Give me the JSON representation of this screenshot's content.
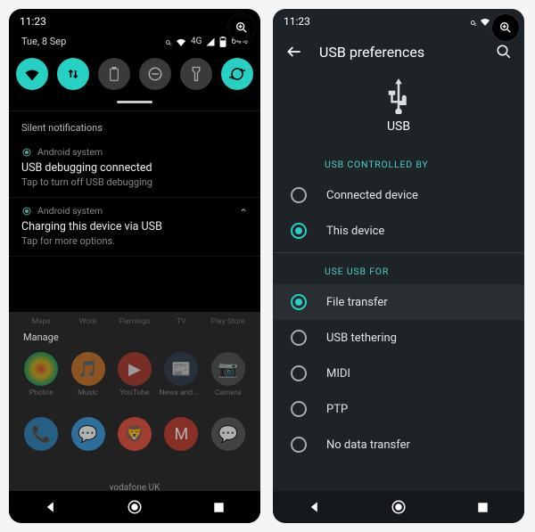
{
  "left": {
    "status": {
      "time": "11:23"
    },
    "qs": {
      "date": "Tue, 8 Sep",
      "signal_text": "4G",
      "battery_text": "64%"
    },
    "silent_label": "Silent notifications",
    "notif1": {
      "app": "Android system",
      "title": "USB debugging connected",
      "body": "Tap to turn off USB debugging"
    },
    "notif2": {
      "app": "Android system",
      "title": "Charging this device via USB",
      "body": "Tap for more options."
    },
    "manage_label": "Manage",
    "apps_top": [
      "Maps",
      "Work",
      "Flamingo",
      "TV",
      "Play Store"
    ],
    "apps_mid": [
      "Photos",
      "Music",
      "YouTube",
      "News and Sport",
      "Camera"
    ],
    "carrier": "vodafone UK"
  },
  "right": {
    "status": {
      "time": "11:23"
    },
    "appbar": {
      "title": "USB preferences"
    },
    "hero": {
      "label": "USB"
    },
    "group1": {
      "label": "USB CONTROLLED BY",
      "opt1": "Connected device",
      "opt2": "This device"
    },
    "group2": {
      "label": "USE USB FOR",
      "opt1": "File transfer",
      "opt2": "USB tethering",
      "opt3": "MIDI",
      "opt4": "PTP",
      "opt5": "No data transfer"
    }
  }
}
